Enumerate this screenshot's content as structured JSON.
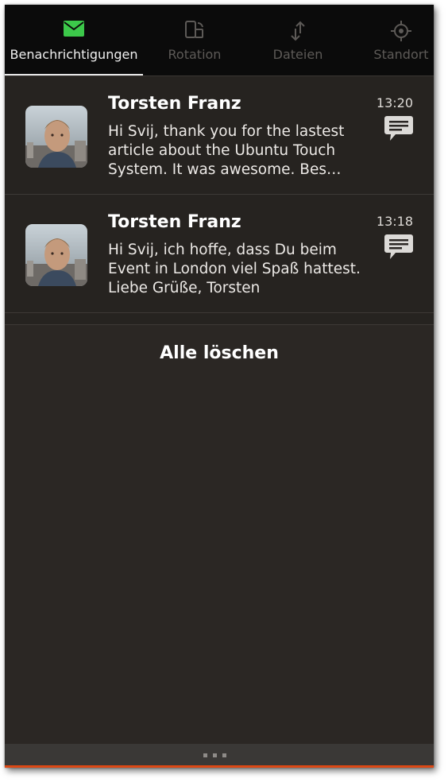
{
  "tabs": [
    {
      "label": "Benachrichtigungen",
      "icon": "envelope-icon",
      "active": true,
      "color": "#3cc84a"
    },
    {
      "label": "Rotation",
      "icon": "rotation-icon",
      "active": false
    },
    {
      "label": "Dateien",
      "icon": "transfer-icon",
      "active": false
    },
    {
      "label": "Standort",
      "icon": "location-icon",
      "active": false
    }
  ],
  "notifications": [
    {
      "sender": "Torsten Franz",
      "body": "Hi Svij, thank you for the lastest article about the Ubuntu Touch System. It was awesome. Bes…",
      "time": "13:20",
      "icon": "message-bubble-icon"
    },
    {
      "sender": "Torsten Franz",
      "body": "Hi Svij, ich hoffe, dass Du beim Event in London viel Spaß hattest. Liebe Grüße, Torsten",
      "time": "13:18",
      "icon": "message-bubble-icon"
    }
  ],
  "clear_all_label": "Alle löschen",
  "colors": {
    "background": "#2b2724",
    "tabbar": "#0b0b0b",
    "accent": "#dd4814",
    "active_icon": "#3cc84a"
  }
}
